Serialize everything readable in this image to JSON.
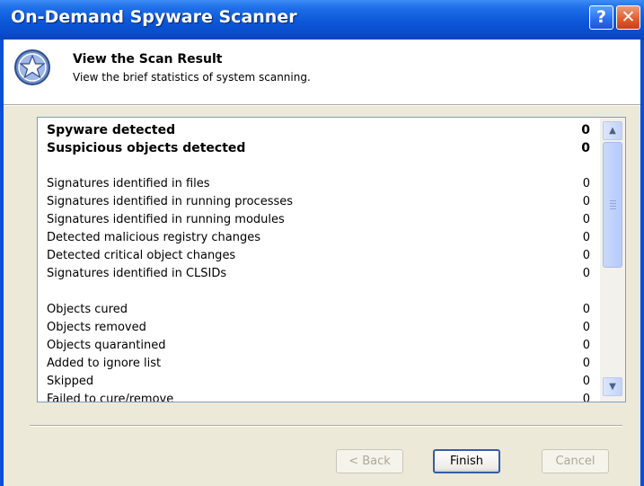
{
  "window": {
    "title": "On-Demand Spyware Scanner"
  },
  "titlebar": {
    "help_glyph": "?",
    "close_glyph": "✕"
  },
  "header": {
    "title": "View the Scan Result",
    "subtitle": "View the brief statistics of system scanning.",
    "icon": "star-shield-icon"
  },
  "results": [
    {
      "label": "Spyware detected",
      "value": "0",
      "bold": true
    },
    {
      "label": "Suspicious objects detected",
      "value": "0",
      "bold": true
    },
    {
      "label": "Signatures identified in files",
      "value": "0"
    },
    {
      "label": "Signatures identified in running processes",
      "value": "0"
    },
    {
      "label": "Signatures identified in running modules",
      "value": "0"
    },
    {
      "label": "Detected malicious registry changes",
      "value": "0"
    },
    {
      "label": "Detected critical object changes",
      "value": "0"
    },
    {
      "label": "Signatures identified in CLSIDs",
      "value": "0"
    },
    {
      "label": "Objects cured",
      "value": "0"
    },
    {
      "label": "Objects removed",
      "value": "0"
    },
    {
      "label": "Objects quarantined",
      "value": "0"
    },
    {
      "label": "Added to ignore list",
      "value": "0"
    },
    {
      "label": "Skipped",
      "value": "0"
    },
    {
      "label": "Failed to cure/remove",
      "value": "0"
    }
  ],
  "scrollbar": {
    "up_glyph": "▲",
    "down_glyph": "▼"
  },
  "buttons": {
    "back": "< Back",
    "finish": "Finish",
    "cancel": "Cancel"
  },
  "colors": {
    "titlebar": "#0a4fd6",
    "dialog": "#ece9d8",
    "accent": "#335ea8"
  }
}
